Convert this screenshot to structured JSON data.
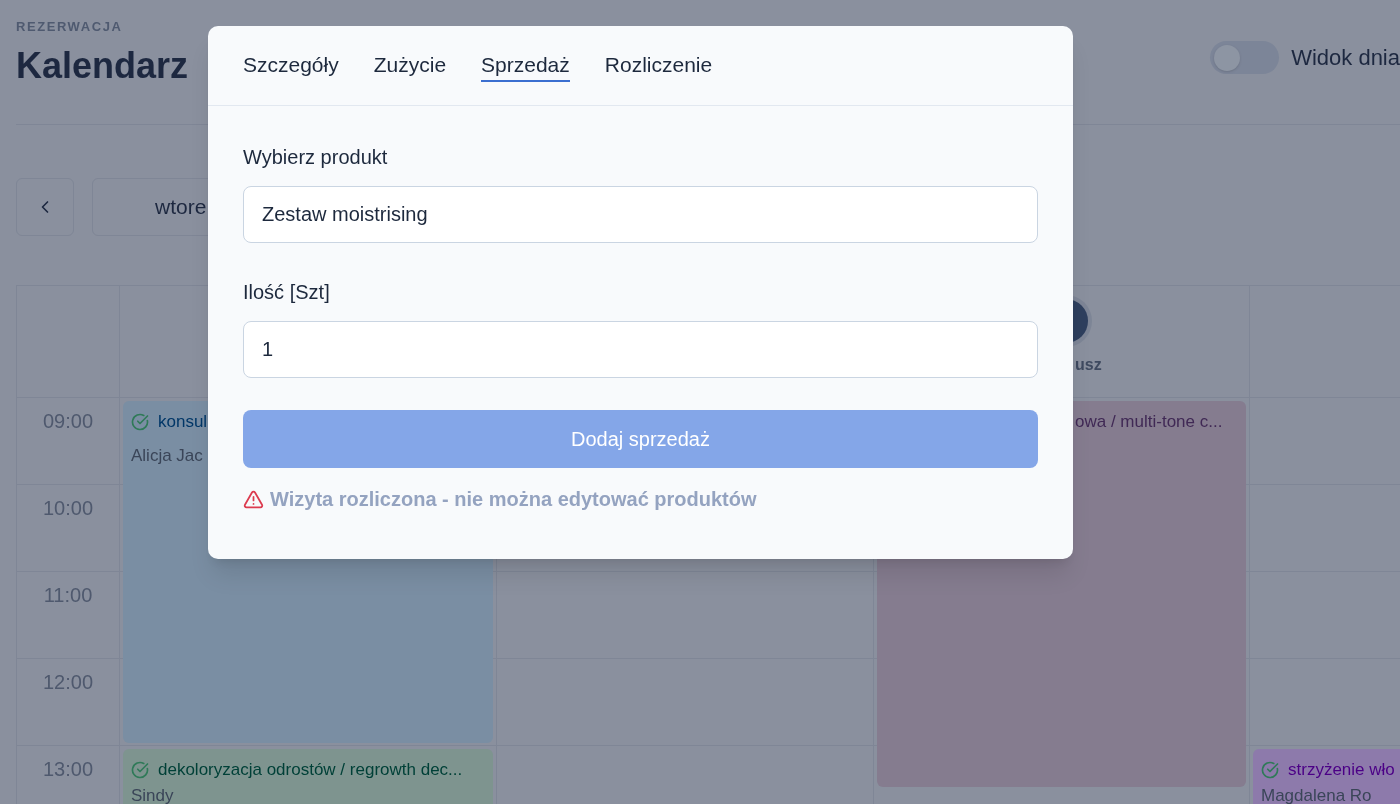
{
  "header": {
    "eyebrow": "REZERWACJA",
    "title": "Kalendarz",
    "view_toggle": {
      "label": "Widok dnia",
      "on": false
    }
  },
  "date_nav": {
    "date": "wtore"
  },
  "calendar": {
    "hours": [
      "09:00",
      "10:00",
      "11:00",
      "12:00",
      "13:00"
    ],
    "columns": [
      {
        "events": [
          {
            "title": "konsul",
            "client": "Alicja Jac",
            "color": "#7a8ea3"
          },
          {
            "title": "dekoloryzacja odrostów / regrowth dec...",
            "client": "Sindy",
            "color": "#7e948f"
          }
        ]
      },
      {},
      {
        "staff": "usz",
        "events": [
          {
            "title": "owa / multi-tone c...",
            "color": "#857c8f"
          }
        ]
      },
      {
        "events": [
          {
            "title": "strzyżenie wło",
            "client": "Magdalena Ro",
            "color": "#8d7aab"
          }
        ]
      }
    ]
  },
  "modal": {
    "tabs": [
      {
        "label": "Szczegóły",
        "selected": false
      },
      {
        "label": "Zużycie",
        "selected": false
      },
      {
        "label": "Sprzedaż",
        "selected": true
      },
      {
        "label": "Rozliczenie",
        "selected": false
      }
    ],
    "fields": [
      {
        "label": "Wybierz produkt",
        "value": "Zestaw moistrising"
      },
      {
        "label": "Ilość [Szt]",
        "value": "1"
      }
    ],
    "submit": {
      "label": "Dodaj sprzedaż",
      "disabled": true
    },
    "warning": "Wizyta rozliczona - nie można edytować produktów"
  }
}
